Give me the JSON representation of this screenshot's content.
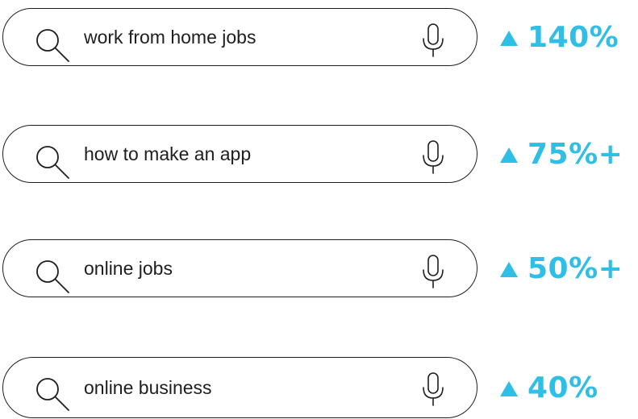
{
  "colors": {
    "accent": "#2fbfe6",
    "outline": "#1e1e1e",
    "background": "#ffffff"
  },
  "searches": [
    {
      "query": "work from home jobs",
      "trend": "140%",
      "icon": "search-icon",
      "voice_icon": "mic-icon",
      "trend_icon": "up-arrow-icon"
    },
    {
      "query": "how to make an app",
      "trend": "75%+",
      "icon": "search-icon",
      "voice_icon": "mic-icon",
      "trend_icon": "up-arrow-icon"
    },
    {
      "query": "online jobs",
      "trend": "50%+",
      "icon": "search-icon",
      "voice_icon": "mic-icon",
      "trend_icon": "up-arrow-icon"
    },
    {
      "query": "online business",
      "trend": "40%",
      "icon": "search-icon",
      "voice_icon": "mic-icon",
      "trend_icon": "up-arrow-icon"
    }
  ]
}
